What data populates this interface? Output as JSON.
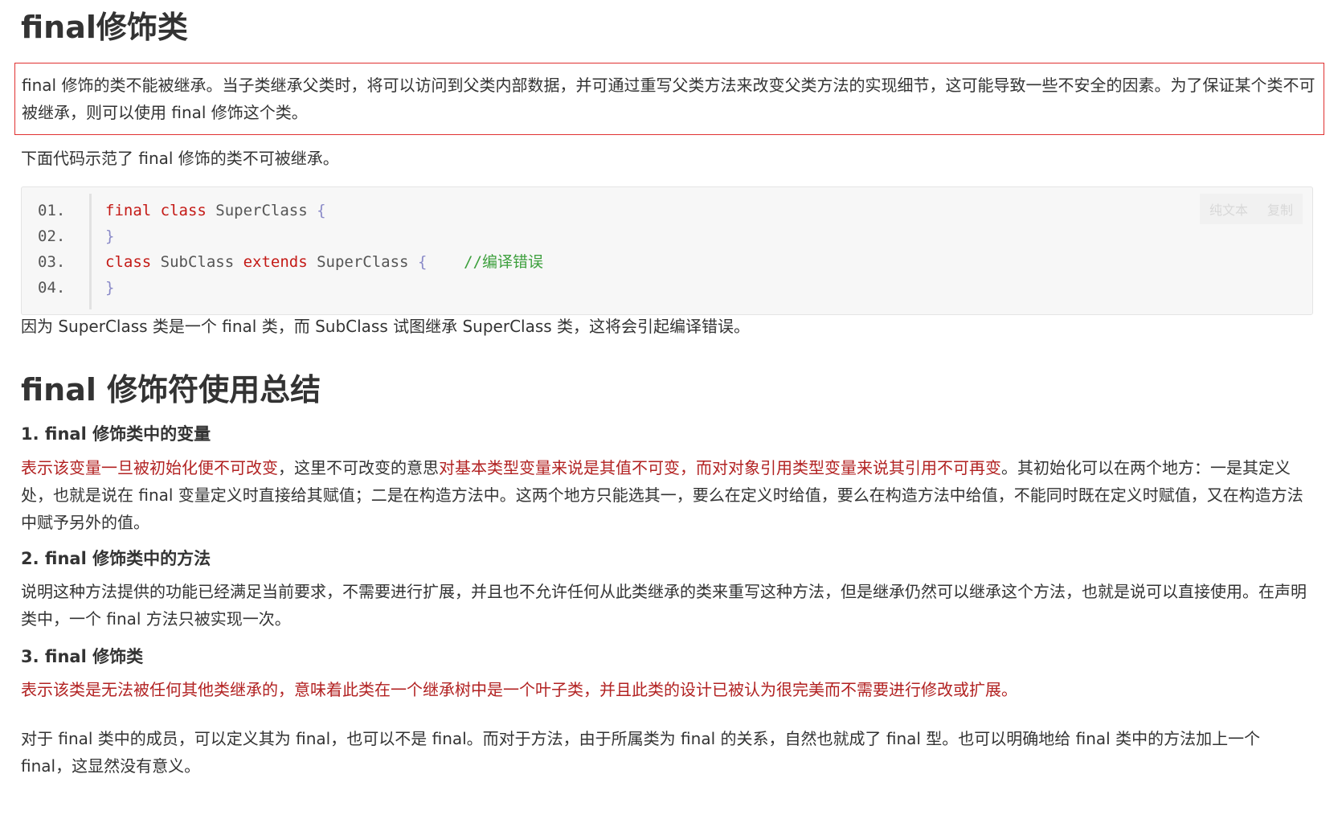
{
  "title1": "final修饰类",
  "note": "final 修饰的类不能被继承。当子类继承父类时，将可以访问到父类内部数据，并可通过重写父类方法来改变父类方法的实现细节，这可能导致一些不安全的因素。为了保证某个类不可被继承，则可以使用 final 修饰这个类。",
  "code_intro": "下面代码示范了 final 修饰的类不可被继承。",
  "code": {
    "toolbar": {
      "plain": "纯文本",
      "copy": "复制"
    },
    "lines": [
      {
        "num": "01.",
        "parts": [
          {
            "t": "final",
            "k": "kw"
          },
          {
            "t": " "
          },
          {
            "t": "class",
            "k": "kw"
          },
          {
            "t": " SuperClass "
          },
          {
            "t": "{",
            "k": "br"
          }
        ]
      },
      {
        "num": "02.",
        "parts": [
          {
            "t": "}",
            "k": "br"
          }
        ]
      },
      {
        "num": "03.",
        "parts": [
          {
            "t": "class",
            "k": "kw"
          },
          {
            "t": " SubClass "
          },
          {
            "t": "extends",
            "k": "kw"
          },
          {
            "t": " SuperClass "
          },
          {
            "t": "{",
            "k": "br"
          },
          {
            "t": "    "
          },
          {
            "t": "//编译错误",
            "k": "cm"
          }
        ]
      },
      {
        "num": "04.",
        "parts": [
          {
            "t": "}",
            "k": "br"
          }
        ]
      }
    ]
  },
  "code_after": "因为 SuperClass 类是一个 final 类，而 SubClass 试图继承 SuperClass 类，这将会引起编译错误。",
  "title2": "final 修饰符使用总结",
  "s1": {
    "heading": "1. final 修饰类中的变量",
    "red_a": "表示该变量一旦被初始化便不可改变",
    "text_a": "，这里不可改变的意思",
    "red_b": "对基本类型变量来说是其值不可变，而对对象引用类型变量来说其引用不可再变",
    "text_b": "。其初始化可以在两个地方：一是其定义处，也就是说在 final 变量定义时直接给其赋值；二是在构造方法中。这两个地方只能选其一，要么在定义时给值，要么在构造方法中给值，不能同时既在定义时赋值，又在构造方法中赋予另外的值。"
  },
  "s2": {
    "heading": "2. final 修饰类中的方法",
    "text": "说明这种方法提供的功能已经满足当前要求，不需要进行扩展，并且也不允许任何从此类继承的类来重写这种方法，但是继承仍然可以继承这个方法，也就是说可以直接使用。在声明类中，一个 final 方法只被实现一次。"
  },
  "s3": {
    "heading": "3. final 修饰类",
    "red": "表示该类是无法被任何其他类继承的，意味着此类在一个继承树中是一个叶子类，并且此类的设计已被认为很完美而不需要进行修改或扩展。"
  },
  "final_para": "对于 final 类中的成员，可以定义其为 final，也可以不是 final。而对于方法，由于所属类为 final 的关系，自然也就成了 final 型。也可以明确地给 final 类中的方法加上一个 final，这显然没有意义。"
}
